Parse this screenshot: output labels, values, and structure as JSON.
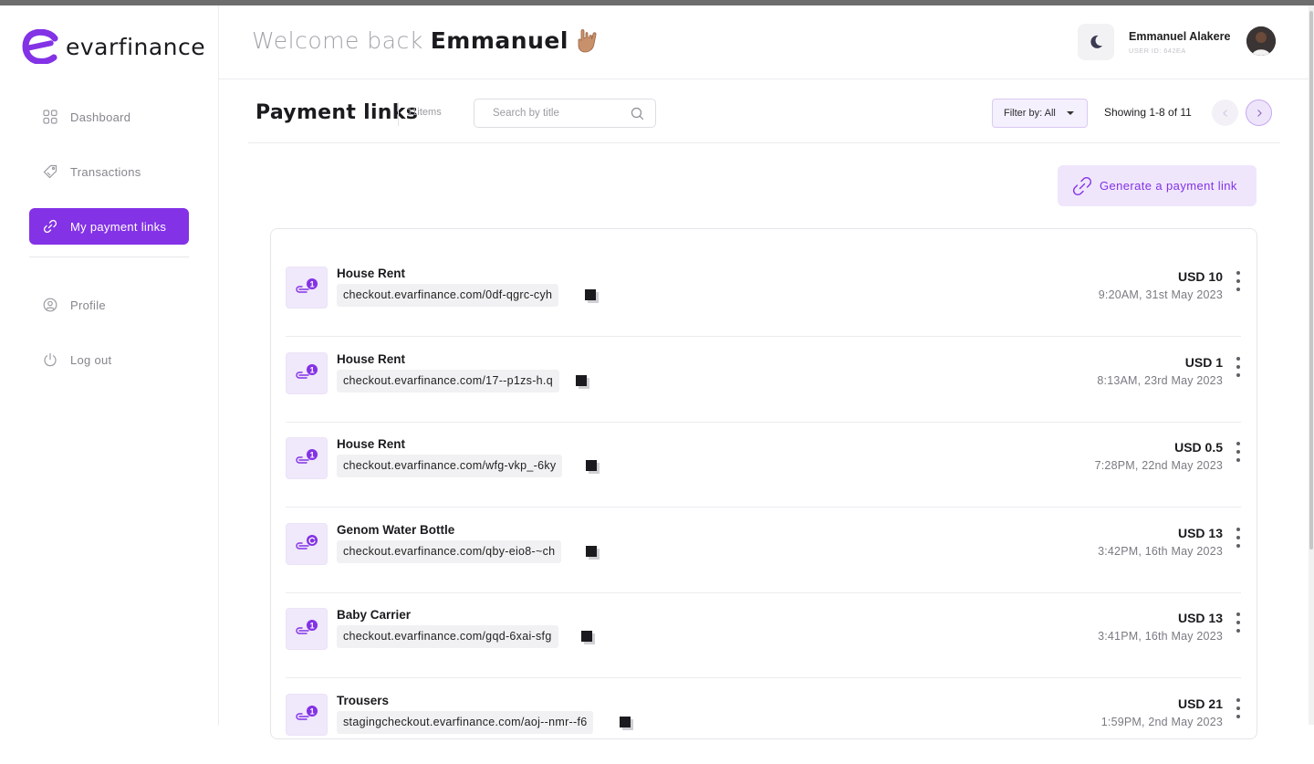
{
  "brand": {
    "name": "evarfinance",
    "accent": "#8332e6"
  },
  "sidebar": {
    "items": [
      {
        "label": "Dashboard",
        "icon": "grid-icon",
        "active": false
      },
      {
        "label": "Transactions",
        "icon": "tag-icon",
        "active": false
      },
      {
        "label": "My payment links",
        "icon": "link-icon",
        "active": true
      }
    ],
    "items_bottom": [
      {
        "label": "Profile",
        "icon": "user-circle-icon"
      },
      {
        "label": "Log out",
        "icon": "power-icon"
      }
    ]
  },
  "header": {
    "welcome_prefix": "Welcome back",
    "welcome_name": "Emmanuel",
    "user_name": "Emmanuel Alakere",
    "user_id": "USER ID: 642EA"
  },
  "toolbar": {
    "title": "Payment links",
    "count": "11items",
    "search_placeholder": "Search by title",
    "filter_label": "Filter by: All",
    "showing": "Showing 1-8 of 11"
  },
  "generate_button": "Generate a payment link",
  "links": [
    {
      "title": "House Rent",
      "url": "checkout.evarfinance.com/0df-qgrc-cyh",
      "amount": "USD 10",
      "date": "9:20AM, 31st May 2023",
      "badge": "1"
    },
    {
      "title": "House Rent",
      "url": "checkout.evarfinance.com/17--p1zs-h.q",
      "amount": "USD 1",
      "date": "8:13AM, 23rd May 2023",
      "badge": "1"
    },
    {
      "title": "House Rent",
      "url": "checkout.evarfinance.com/wfg-vkp_-6ky",
      "amount": "USD 0.5",
      "date": "7:28PM, 22nd May 2023",
      "badge": "1"
    },
    {
      "title": "Genom Water Bottle",
      "url": "checkout.evarfinance.com/qby-eio8-~ch",
      "amount": "USD 13",
      "date": "3:42PM, 16th May 2023",
      "badge": "refresh"
    },
    {
      "title": "Baby Carrier",
      "url": "checkout.evarfinance.com/gqd-6xai-sfg",
      "amount": "USD 13",
      "date": "3:41PM, 16th May 2023",
      "badge": "1"
    },
    {
      "title": "Trousers",
      "url": "stagingcheckout.evarfinance.com/aoj--nmr--f6",
      "amount": "USD 21",
      "date": "1:59PM, 2nd May 2023",
      "badge": "1"
    }
  ]
}
